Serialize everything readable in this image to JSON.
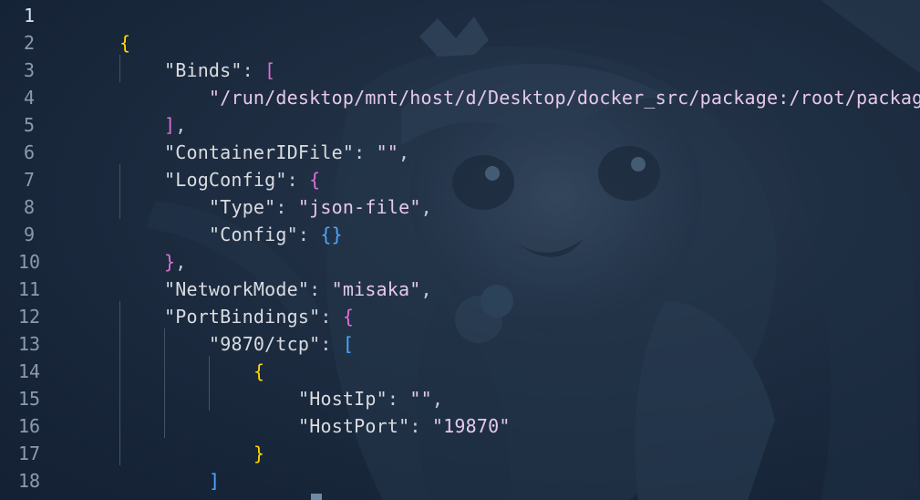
{
  "editor": {
    "line_numbers": [
      "1",
      "2",
      "3",
      "4",
      "5",
      "6",
      "7",
      "8",
      "9",
      "10",
      "11",
      "12",
      "13",
      "14",
      "15",
      "16",
      "17",
      "18"
    ],
    "active_line": "1",
    "code": {
      "l1": {
        "open": "{"
      },
      "l2": {
        "key": "\"Binds\"",
        "colon": ": ",
        "open": "["
      },
      "l3": {
        "str": "\"/run/desktop/mnt/host/d/Desktop/docker_src/package:/root/package\""
      },
      "l4": {
        "close": "]",
        "comma": ","
      },
      "l5": {
        "key": "\"ContainerIDFile\"",
        "colon": ": ",
        "val": "\"\"",
        "comma": ","
      },
      "l6": {
        "key": "\"LogConfig\"",
        "colon": ": ",
        "open": "{"
      },
      "l7": {
        "key": "\"Type\"",
        "colon": ": ",
        "val": "\"json-file\"",
        "comma": ","
      },
      "l8": {
        "key": "\"Config\"",
        "colon": ": ",
        "val": "{}"
      },
      "l9": {
        "close": "}",
        "comma": ","
      },
      "l10": {
        "key": "\"NetworkMode\"",
        "colon": ": ",
        "val": "\"misaka\"",
        "comma": ","
      },
      "l11": {
        "key": "\"PortBindings\"",
        "colon": ": ",
        "open": "{"
      },
      "l12": {
        "key": "\"9870/tcp\"",
        "colon": ": ",
        "open": "["
      },
      "l13": {
        "open": "{"
      },
      "l14": {
        "key": "\"HostIp\"",
        "colon": ": ",
        "val": "\"\"",
        "comma": ","
      },
      "l15": {
        "key": "\"HostPort\"",
        "colon": ": ",
        "val": "\"19870\""
      },
      "l16": {
        "close": "}"
      },
      "l17": {
        "close": "]"
      },
      "l18": {
        "close": "}",
        "comma": ","
      }
    }
  },
  "colors": {
    "background": "#1b2a3e",
    "line_number": "#8a9bb0",
    "text": "#d9dce1",
    "bracket_level_1": "#ffd700",
    "bracket_level_2": "#da70d6",
    "bracket_level_3": "#4fa6ff"
  }
}
